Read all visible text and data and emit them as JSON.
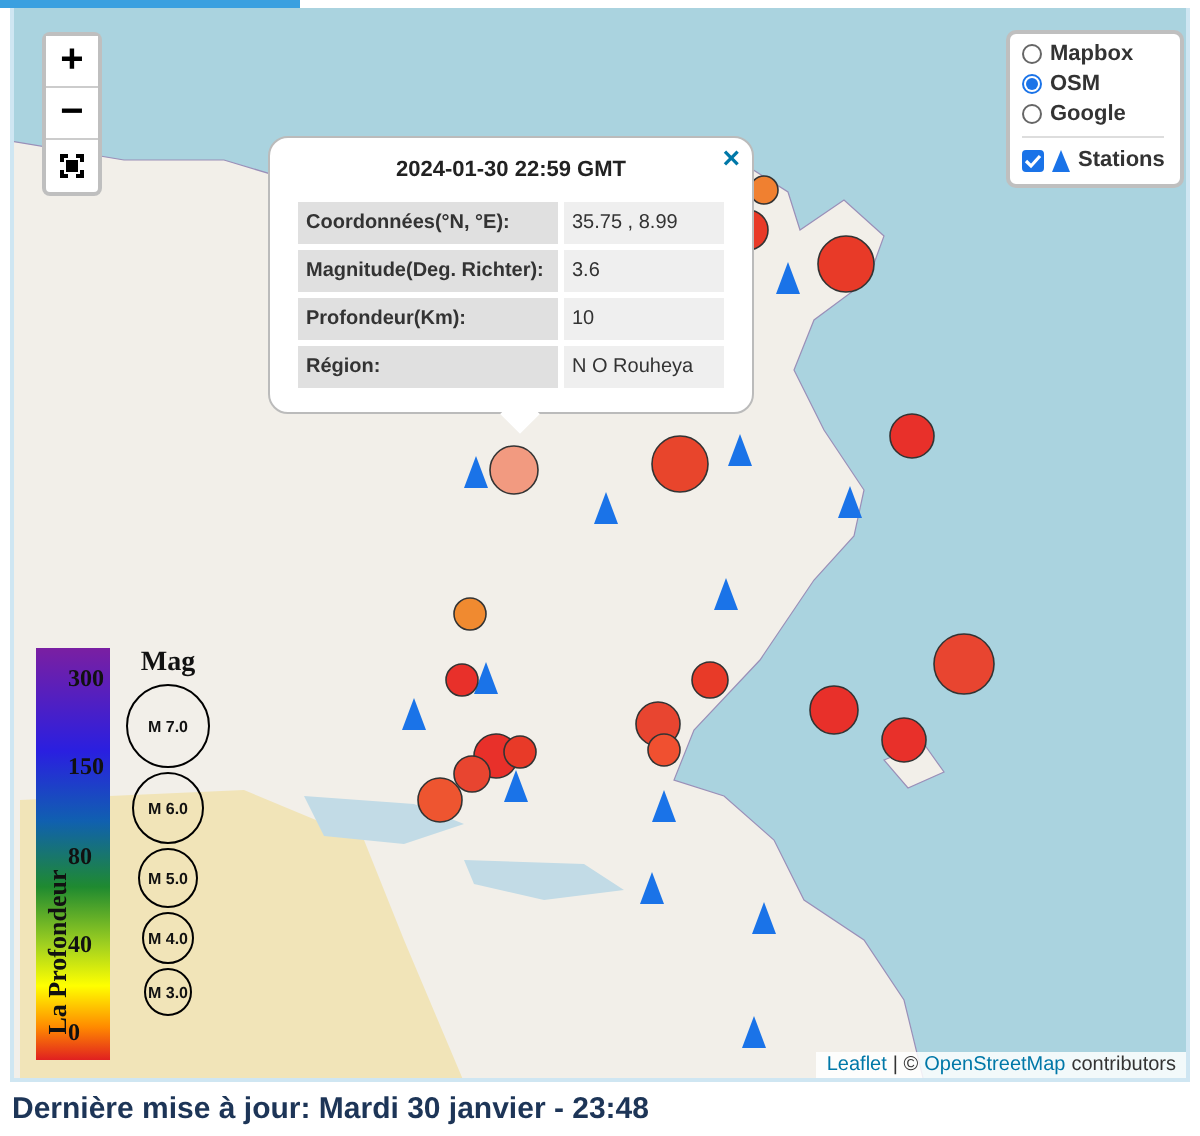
{
  "map": {
    "zoom_controls": [
      "+",
      "−"
    ],
    "layers": [
      {
        "label": "Mapbox",
        "selected": false
      },
      {
        "label": "OSM",
        "selected": true
      },
      {
        "label": "Google",
        "selected": false
      }
    ],
    "overlay": {
      "label": "Stations",
      "checked": true
    },
    "popup": {
      "close": "×",
      "title": "2024-01-30 22:59 GMT",
      "rows": [
        {
          "label": "Coordonnées(°N, °E):",
          "value": "35.75 , 8.99"
        },
        {
          "label": "Magnitude(Deg. Richter):",
          "value": "3.6"
        },
        {
          "label": "Profondeur(Km):",
          "value": "10"
        },
        {
          "label": "Région:",
          "value": "N O Rouheya"
        }
      ]
    },
    "earthquakes": [
      {
        "color": "#f29a80"
      },
      {
        "color": "#e8452c"
      },
      {
        "color": "#e8302a"
      },
      {
        "color": "#e83a28"
      },
      {
        "color": "#f08030"
      },
      {
        "color": "#e83a28"
      },
      {
        "color": "#e84530"
      },
      {
        "color": "#e8302a"
      },
      {
        "color": "#e8302a"
      },
      {
        "color": "#e84530"
      },
      {
        "color": "#e83a28"
      },
      {
        "color": "#f08a30"
      },
      {
        "color": "#e8302a"
      },
      {
        "color": "#e8302a"
      },
      {
        "color": "#e83a28"
      },
      {
        "color": "#e84530"
      },
      {
        "color": "#ee5530"
      },
      {
        "color": "#f05030"
      }
    ],
    "legend": {
      "depth_title": "La Profondeur",
      "depth_ticks": [
        "300",
        "150",
        "80",
        "40",
        "0"
      ],
      "mag_title": "Mag",
      "mag_circles": [
        "M 7.0",
        "M 6.0",
        "M 5.0",
        "M 4.0",
        "M 3.0"
      ]
    },
    "attribution": {
      "leaflet": "Leaflet",
      "separator": "| ©",
      "osm": "OpenStreetMap",
      "suffix": "contributors"
    }
  },
  "last_update": "Dernière mise à jour: Mardi 30 janvier - 23:48"
}
